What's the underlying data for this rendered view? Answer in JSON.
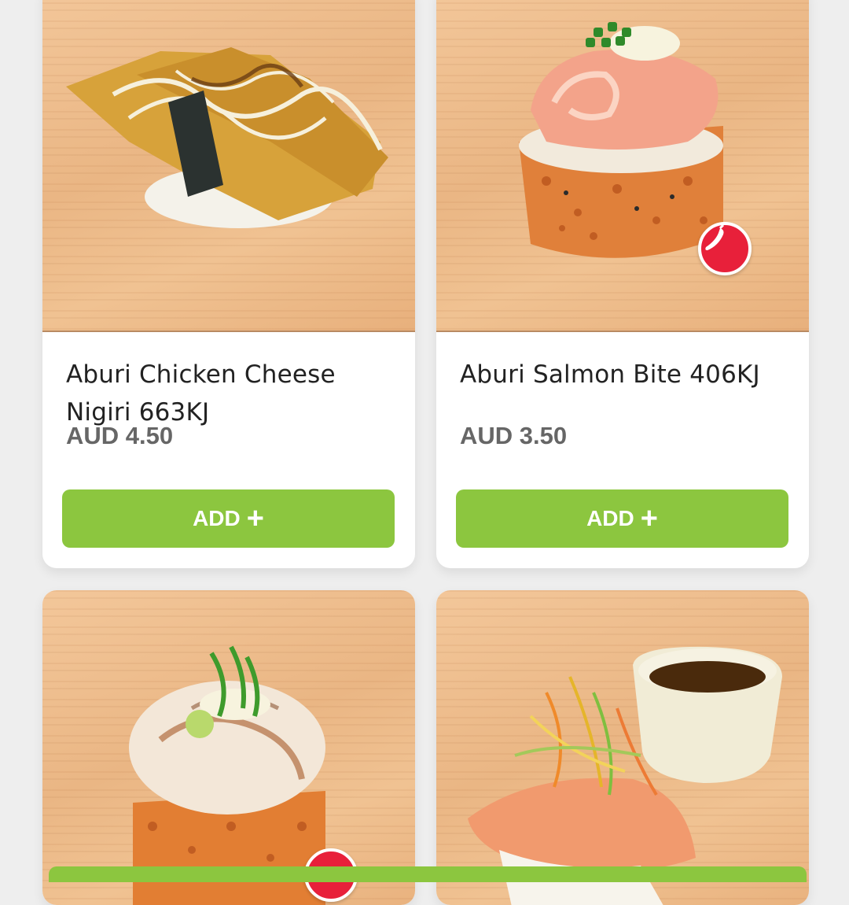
{
  "products": [
    {
      "name": "Aburi Chicken Cheese Nigiri 663KJ",
      "price": "AUD 4.50",
      "add_label": "ADD",
      "add_icon": "plus-icon",
      "spicy": false
    },
    {
      "name": "Aburi Salmon Bite 406KJ",
      "price": "AUD 3.50",
      "add_label": "ADD",
      "add_icon": "plus-icon",
      "spicy": true
    },
    {
      "spicy": true
    },
    {
      "spicy": false
    }
  ],
  "colors": {
    "accent": "#8cc63f",
    "spicy_badge": "#e8203a",
    "price_text": "#666666"
  }
}
